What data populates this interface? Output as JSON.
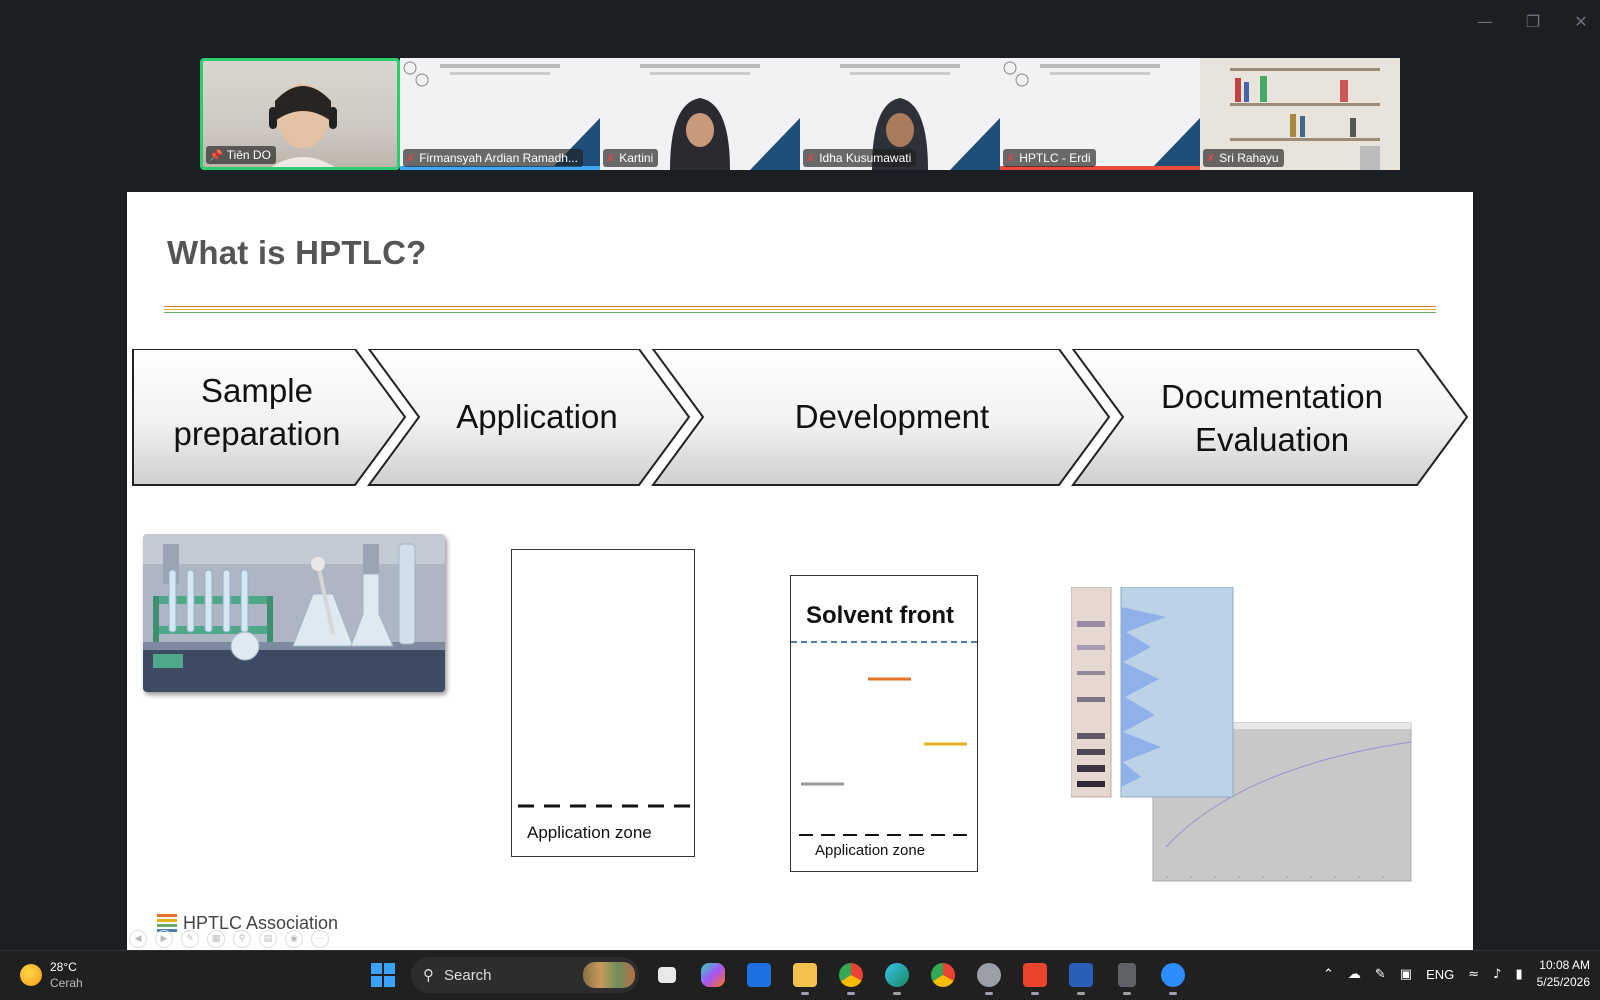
{
  "window": {
    "minimize_icon": "minimize-icon",
    "restore_icon": "restore-icon",
    "close_icon": "close-icon"
  },
  "participants": [
    {
      "name": "Tiên DO",
      "pinned": true,
      "muted": false,
      "active": true
    },
    {
      "name": "Firmansyah Ardian Ramadh...",
      "muted": true
    },
    {
      "name": "Kartini",
      "muted": true
    },
    {
      "name": "Idha Kusumawati",
      "muted": true
    },
    {
      "name": "HPTLC - Erdi",
      "muted": true
    },
    {
      "name": "Sri Rahayu",
      "muted": true
    }
  ],
  "slide": {
    "title": "What is HPTLC?",
    "steps": [
      {
        "line1": "Sample",
        "line2": "preparation"
      },
      {
        "line1": "Application",
        "line2": ""
      },
      {
        "line1": "Development",
        "line2": ""
      },
      {
        "line1": "Documentation",
        "line2": "Evaluation"
      }
    ],
    "plate1_label": "Application zone",
    "plate2_title": "Solvent front",
    "plate2_label": "Application zone",
    "footer_logo": "HPTLC Association",
    "accent_colors": {
      "orange": "#e8742c",
      "yellow": "#e6b21e",
      "gray": "#9a9a9a",
      "blue_dash": "#4a7fb0"
    }
  },
  "taskbar": {
    "weather_temp": "28°C",
    "weather_desc": "Cerah",
    "search_label": "Search",
    "language": "ENG",
    "time": "10:08 AM",
    "date": "5/25/2026"
  }
}
